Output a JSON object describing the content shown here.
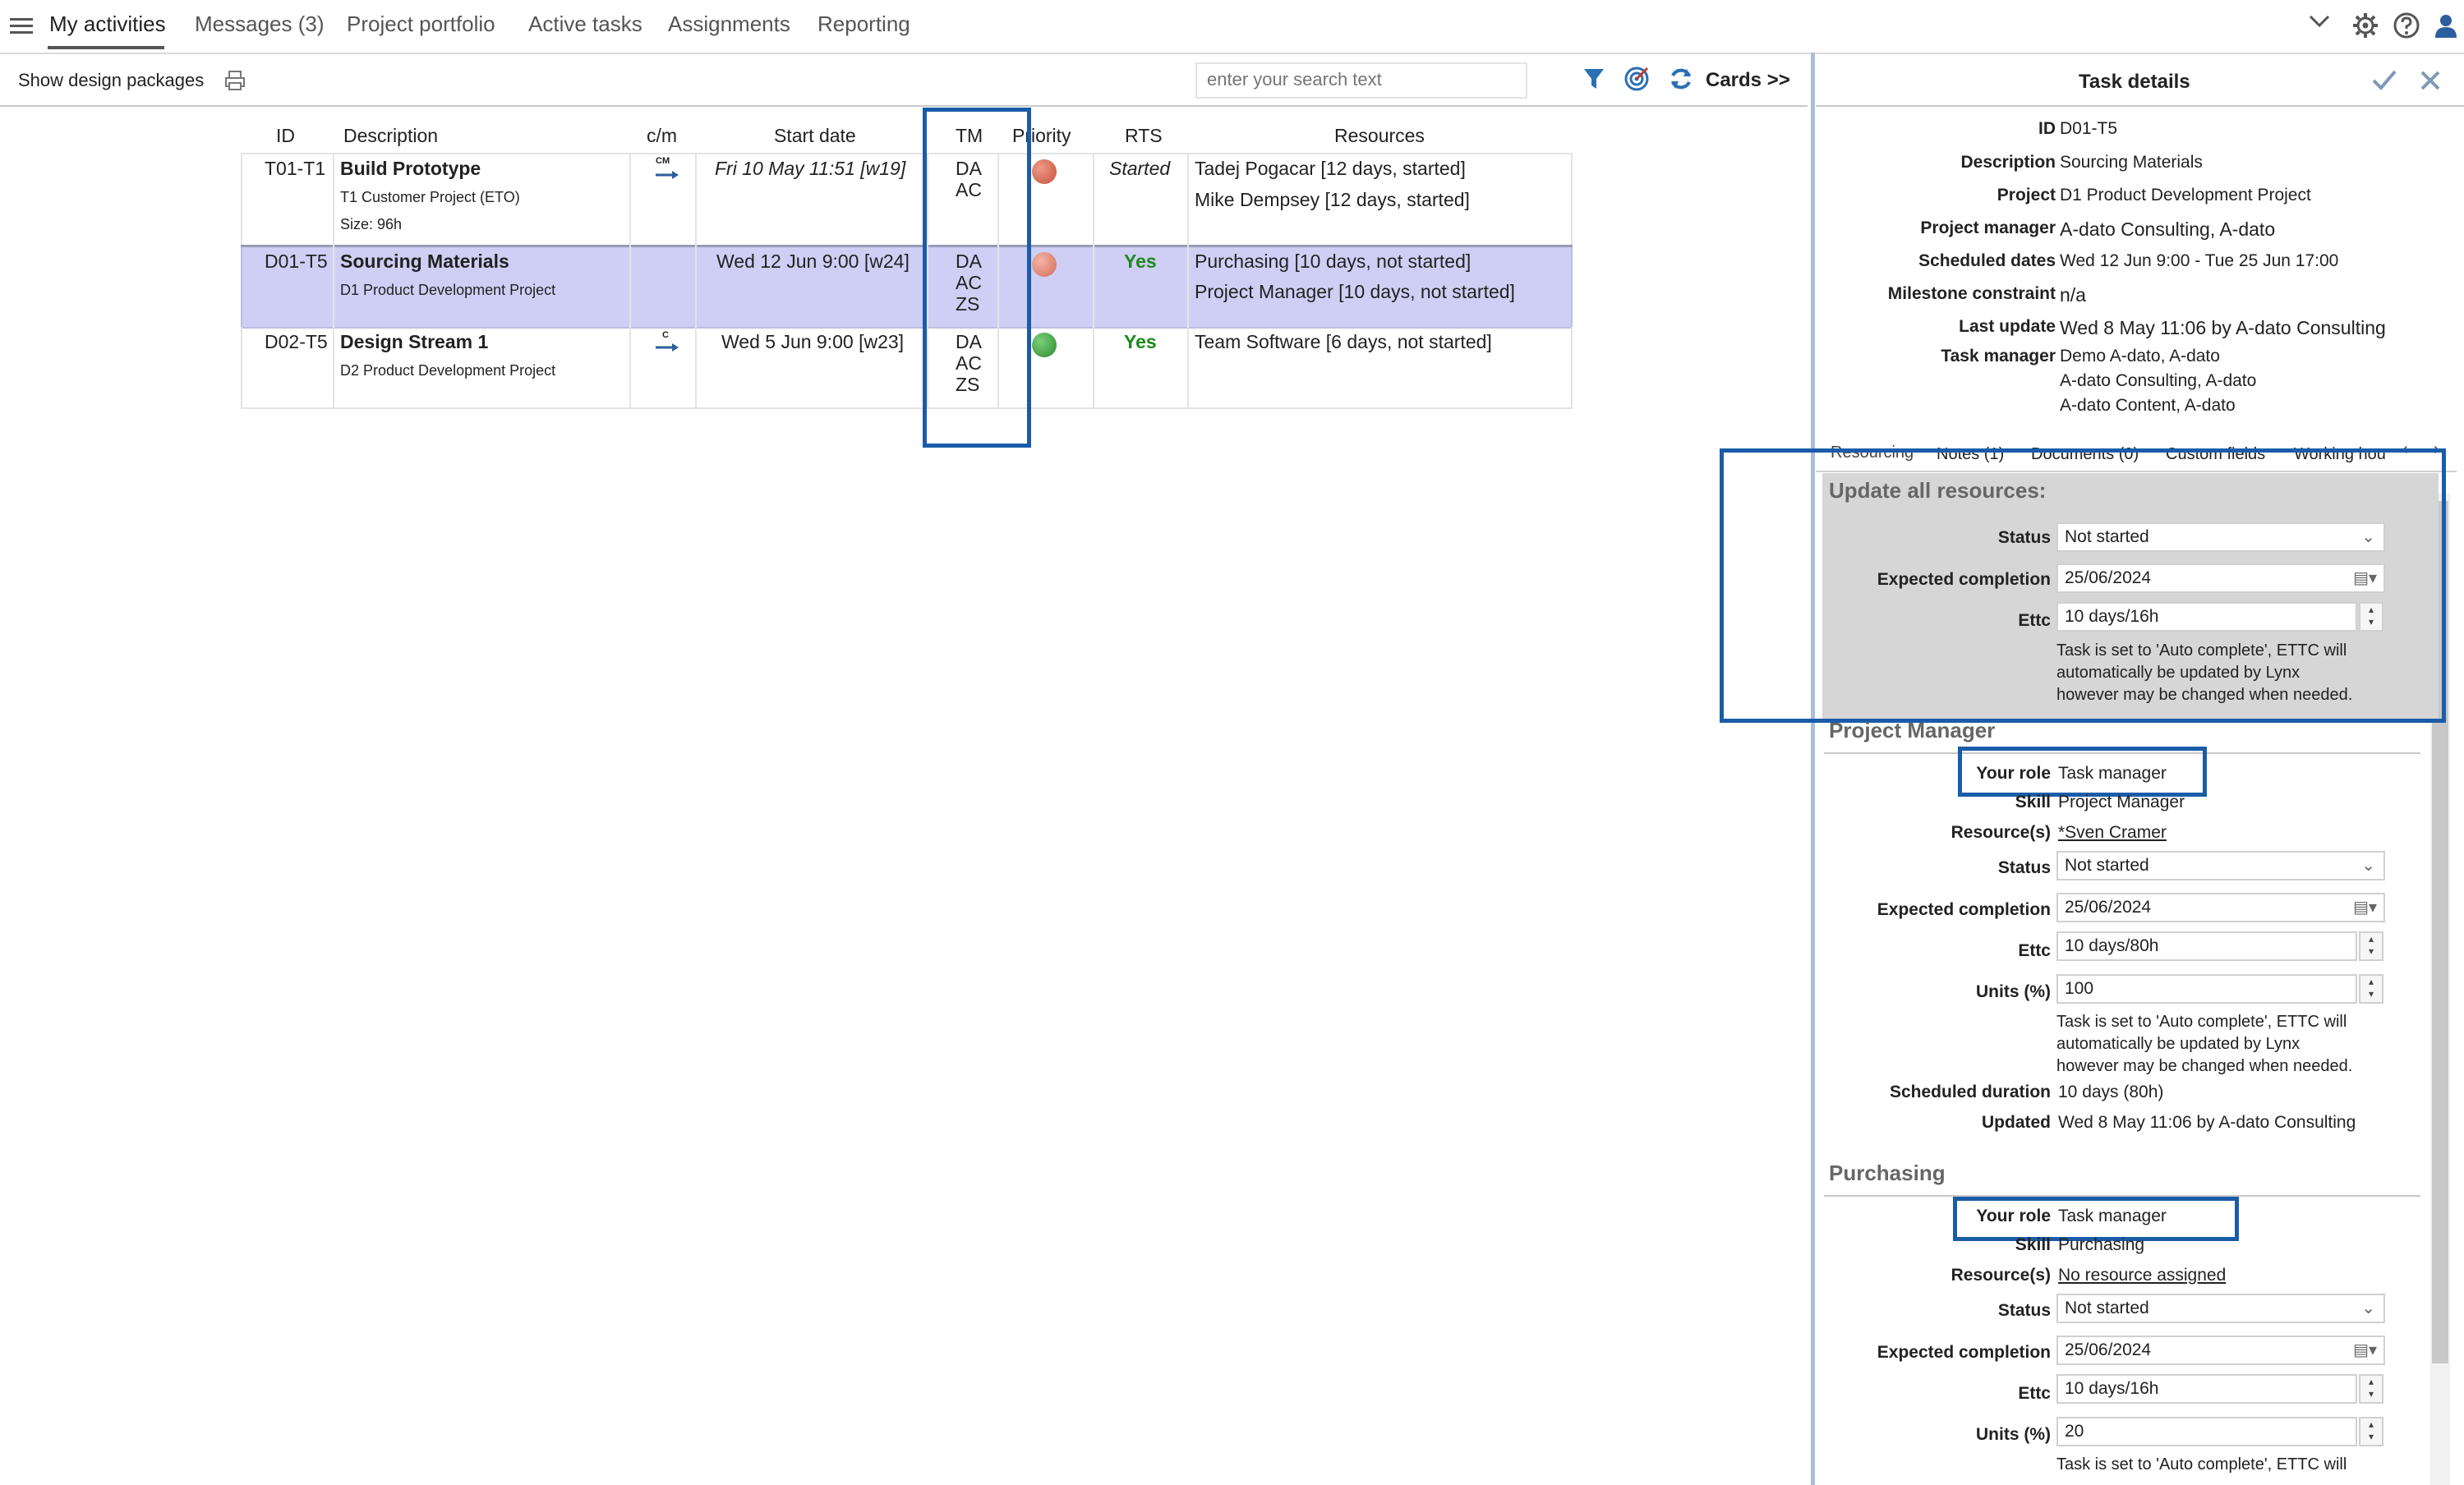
{
  "nav": {
    "items": [
      "My activities",
      "Messages (3)",
      "Project portfolio",
      "Active tasks",
      "Assignments",
      "Reporting"
    ],
    "active_index": 0
  },
  "icons": {
    "menu": "hamburger-menu-icon",
    "chevron": "chevron-down-icon",
    "settings": "gear-icon",
    "help": "help-icon",
    "user": "user-icon",
    "print": "print-icon",
    "filter": "filter-icon",
    "target": "target-icon",
    "refresh": "refresh-icon",
    "check": "check-icon",
    "close": "close-icon"
  },
  "toolbar": {
    "show_design_packages": "Show design packages",
    "search_placeholder": "enter your search text",
    "cards_button": "Cards >>"
  },
  "table": {
    "headers": [
      "ID",
      "Description",
      "c/m",
      "Start date",
      "TM",
      "Priority",
      "RTS",
      "Resources"
    ],
    "rows": [
      {
        "id": "T01-T1",
        "description": "Build Prototype",
        "project": "T1 Customer Project (ETO)",
        "size": "Size: 96h",
        "cm": "CM",
        "start_date": "Fri 10 May 11:51 [w19]",
        "tm": [
          "DA",
          "AC"
        ],
        "priority_color": "#d0654f",
        "rts": "Started",
        "resources": [
          "Tadej Pogacar [12 days, started]",
          "Mike Dempsey [12 days, started]"
        ]
      },
      {
        "id": "D01-T5",
        "description": "Sourcing Materials",
        "project": "D1 Product Development Project",
        "size": "",
        "cm": "",
        "start_date": "Wed 12 Jun 9:00 [w24]",
        "tm": [
          "DA",
          "AC",
          "ZS"
        ],
        "priority_color": "#d9806e",
        "rts": "Yes",
        "resources": [
          "Purchasing [10 days, not started]",
          "Project Manager [10 days, not started]"
        ]
      },
      {
        "id": "D02-T5",
        "description": "Design Stream 1",
        "project": "D2 Product Development Project",
        "size": "",
        "cm": "C",
        "start_date": "Wed 5 Jun 9:00 [w23]",
        "tm": [
          "DA",
          "AC",
          "ZS"
        ],
        "priority_color": "#3e9a3e",
        "rts": "Yes",
        "resources": [
          "Team Software [6 days, not started]"
        ]
      }
    ]
  },
  "details": {
    "title": "Task details",
    "fields": [
      {
        "label": "ID",
        "value": "D01-T5"
      },
      {
        "label": "Description",
        "value": "Sourcing Materials"
      },
      {
        "label": "Project",
        "value": "D1 Product Development Project"
      },
      {
        "label": "Project manager",
        "value": "A-dato Consulting, A-dato"
      },
      {
        "label": "Scheduled dates",
        "value": "Wed 12 Jun 9:00 - Tue 25 Jun 17:00"
      },
      {
        "label": "Milestone constraint",
        "value": "n/a"
      },
      {
        "label": "Last update",
        "value": "Wed 8 May 11:06 by A-dato Consulting"
      },
      {
        "label": "Task manager",
        "value": "Demo A-dato, A-dato"
      }
    ],
    "task_manager_extra": [
      "A-dato Consulting, A-dato",
      "A-dato Content, A-dato"
    ],
    "tabs": [
      "Resourcing",
      "Notes (1)",
      "Documents (0)",
      "Custom fields",
      "Working hou"
    ],
    "update_all": {
      "title": "Update all resources:",
      "status_label": "Status",
      "status_value": "Not started",
      "completion_label": "Expected completion",
      "completion_value": "25/06/2024",
      "ettc_label": "Ettc",
      "ettc_value": "10 days/16h",
      "note": [
        "Task is set to 'Auto complete', ETTC will",
        "automatically be updated by Lynx",
        "however may be changed when needed."
      ]
    },
    "sections": [
      {
        "title": "Project Manager",
        "role_label": "Your role",
        "role_value": "Task manager",
        "skill_label": "Skill",
        "skill_value": "Project Manager",
        "resources_label": "Resource(s)",
        "resources_value": "*Sven Cramer",
        "status_label": "Status",
        "status_value": "Not started",
        "completion_label": "Expected completion",
        "completion_value": "25/06/2024",
        "ettc_label": "Ettc",
        "ettc_value": "10 days/80h",
        "units_label": "Units (%)",
        "units_value": "100",
        "note": [
          "Task is set to 'Auto complete', ETTC will",
          "automatically be updated by Lynx",
          "however may be changed when needed."
        ],
        "duration_label": "Scheduled duration",
        "duration_value": "10 days (80h)",
        "updated_label": "Updated",
        "updated_value": "Wed 8 May 11:06 by A-dato Consulting"
      },
      {
        "title": "Purchasing",
        "role_label": "Your role",
        "role_value": "Task manager",
        "skill_label": "Skill",
        "skill_value": "Purchasing",
        "resources_label": "Resource(s)",
        "resources_value": "No resource assigned",
        "status_label": "Status",
        "status_value": "Not started",
        "completion_label": "Expected completion",
        "completion_value": "25/06/2024",
        "ettc_label": "Ettc",
        "ettc_value": "10 days/16h",
        "units_label": "Units (%)",
        "units_value": "20",
        "note": [
          "Task is set to 'Auto complete', ETTC will"
        ]
      }
    ]
  },
  "colors": {
    "accent": "#2b6fb5",
    "highlight_box": "#1b5ca8",
    "selected_row": "#cfcff5",
    "rts_green": "#1c8a1c"
  }
}
